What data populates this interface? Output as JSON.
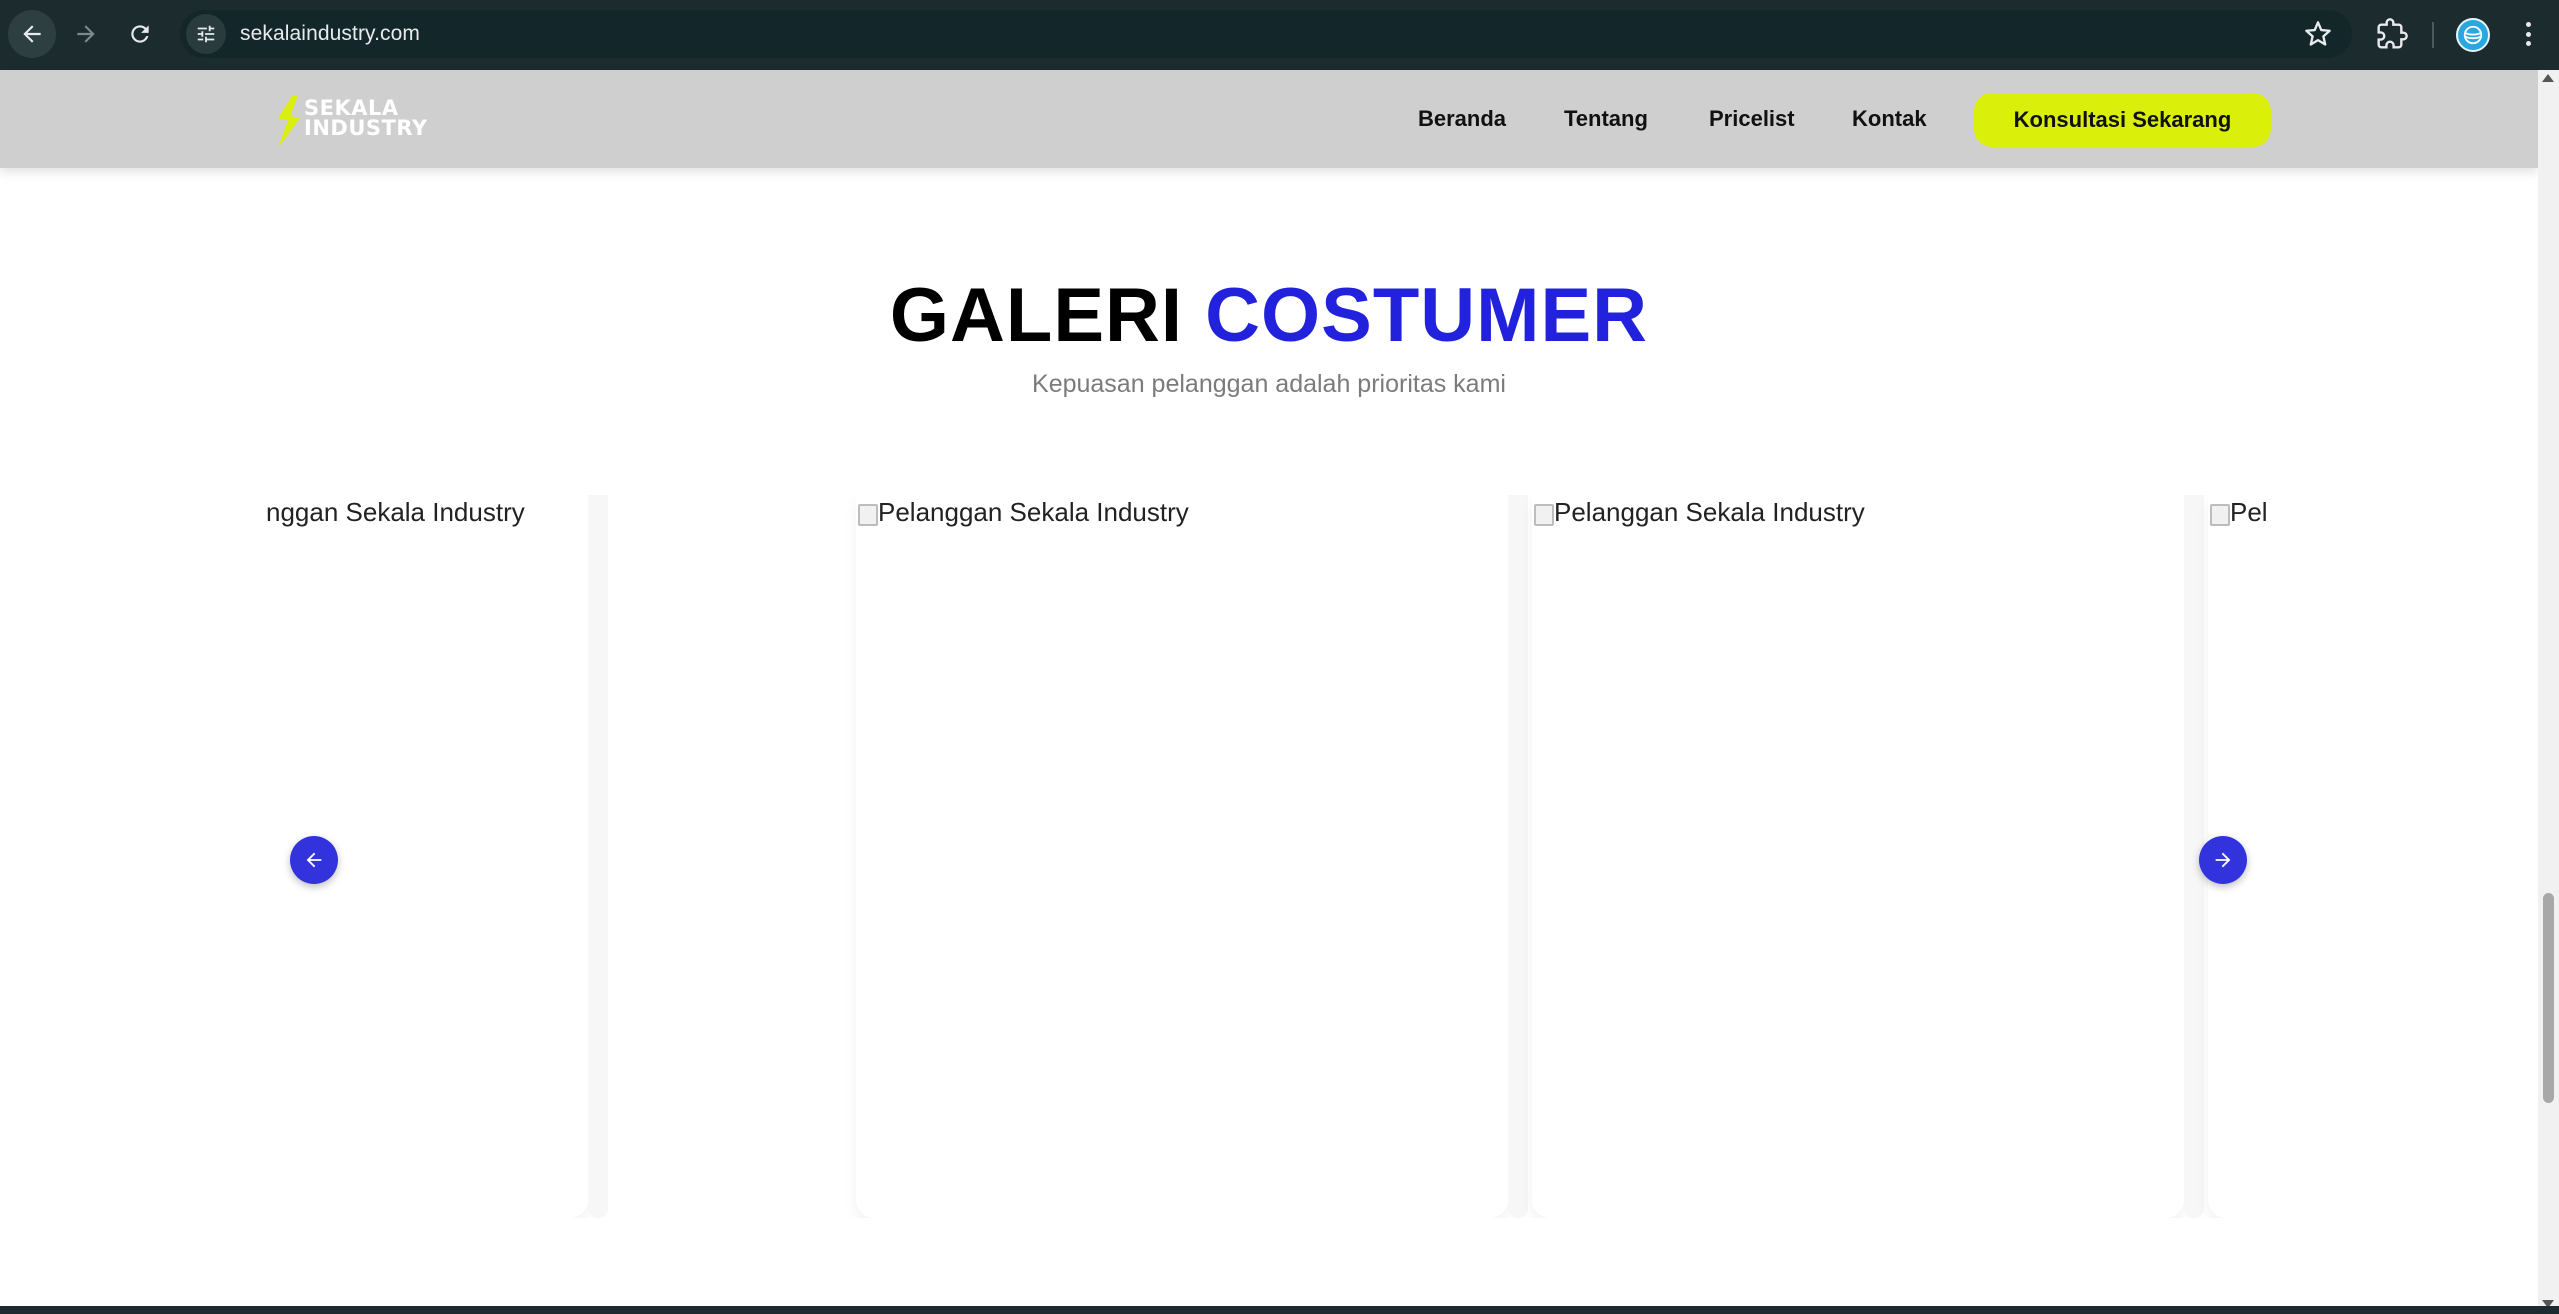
{
  "browser": {
    "url": "sekalaindustry.com",
    "icons": {
      "back": "arrow-left-icon",
      "forward": "arrow-right-icon",
      "reload": "reload-icon",
      "site_info": "tune-icon",
      "bookmark": "star-icon",
      "extensions": "puzzle-icon",
      "profile": "profile-icon",
      "menu": "kebab-menu-icon"
    }
  },
  "header": {
    "logo_line1": "SEKALA",
    "logo_line2": "INDUSTRY",
    "nav": [
      {
        "label": "Beranda"
      },
      {
        "label": "Tentang"
      },
      {
        "label": "Pricelist"
      },
      {
        "label": "Kontak"
      }
    ],
    "cta_label": "Konsultasi Sekarang",
    "colors": {
      "background": "#cfcfcf",
      "cta": "#daf00b",
      "logo_accent": "#daf00b"
    }
  },
  "section": {
    "title_part1": "GALERI",
    "title_part2": "COSTUMER",
    "subtitle": "Kepuasan pelanggan adalah prioritas kami",
    "colors": {
      "title_accent": "#2222dd",
      "arrow": "#3333dd"
    }
  },
  "gallery": {
    "items": [
      {
        "alt": "Pelanggan Sekala Industry",
        "visible_text": "nggan Sekala Industry"
      },
      {
        "alt": "Pelanggan Sekala Industry",
        "visible_text": "Pelanggan Sekala Industry"
      },
      {
        "alt": "Pelanggan Sekala Industry",
        "visible_text": "Pelanggan Sekala Industry"
      },
      {
        "alt": "Pelanggan Sekala Industry",
        "visible_text": "Pel"
      }
    ],
    "prev_icon": "arrow-left-icon",
    "next_icon": "arrow-right-icon"
  }
}
